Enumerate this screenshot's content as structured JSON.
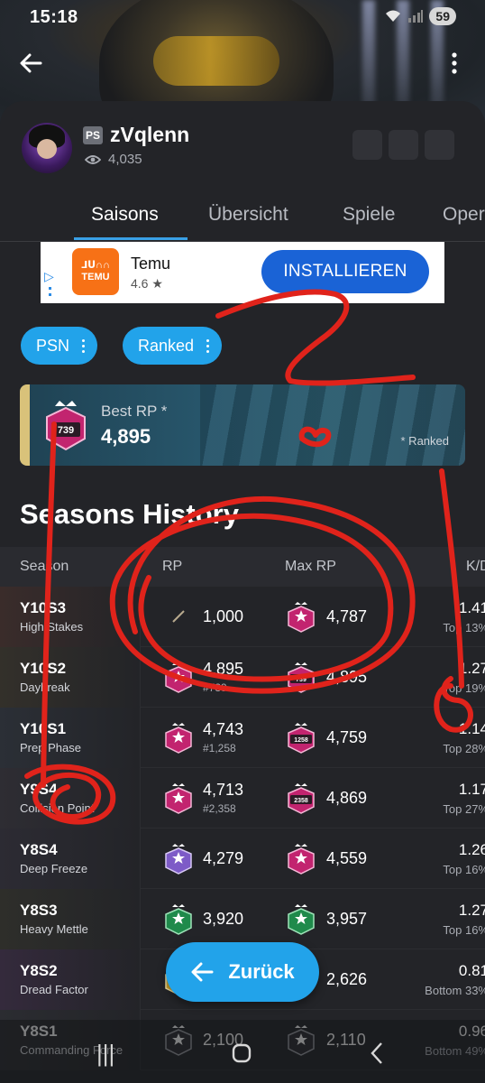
{
  "status": {
    "time": "15:18",
    "battery": "59"
  },
  "profile": {
    "platform_badge": "PS",
    "username": "zVqlenn",
    "views": "4,035"
  },
  "tabs": [
    {
      "label": "Saisons",
      "active": true
    },
    {
      "label": "Übersicht",
      "active": false
    },
    {
      "label": "Spiele",
      "active": false
    },
    {
      "label": "Oper",
      "active": false
    }
  ],
  "ad": {
    "app_name": "Temu",
    "logo_line1": "⅃ᑌ∩∩",
    "logo_line2": "TEMU",
    "rating": "4.6 ★",
    "install_label": "INSTALLIEREN"
  },
  "filters": {
    "platform": "PSN",
    "mode": "Ranked"
  },
  "best_rp": {
    "label": "Best RP *",
    "value": "4,895",
    "badge_number": "739",
    "note": "* Ranked"
  },
  "section_title": "Seasons History",
  "table": {
    "headers": {
      "season": "Season",
      "rp": "RP",
      "max_rp": "Max RP",
      "kd": "K/D"
    },
    "rows": [
      {
        "code": "Y10S3",
        "name": "High Stakes",
        "rp": "1,000",
        "rp_rank": "",
        "max_rp": "4,787",
        "kd": "1.41",
        "kd_rank": "Top 13%",
        "rp_badge": "none",
        "max_badge": "champion",
        "max_badge_text": ""
      },
      {
        "code": "Y10S2",
        "name": "Daybreak",
        "rp": "4,895",
        "rp_rank": "#739",
        "max_rp": "4,895",
        "kd": "1.27",
        "kd_rank": "Top 19%",
        "rp_badge": "champion",
        "max_badge": "champion",
        "max_badge_text": "739"
      },
      {
        "code": "Y10S1",
        "name": "Prep Phase",
        "rp": "4,743",
        "rp_rank": "#1,258",
        "max_rp": "4,759",
        "kd": "1.14",
        "kd_rank": "Top 28%",
        "rp_badge": "champion",
        "max_badge": "champion",
        "max_badge_text": "1258"
      },
      {
        "code": "Y9S4",
        "name": "Collision Point",
        "rp": "4,713",
        "rp_rank": "#2,358",
        "max_rp": "4,869",
        "kd": "1.17",
        "kd_rank": "Top 27%",
        "rp_badge": "champion",
        "max_badge": "champion",
        "max_badge_text": "2358"
      },
      {
        "code": "Y8S4",
        "name": "Deep Freeze",
        "rp": "4,279",
        "rp_rank": "",
        "max_rp": "4,559",
        "kd": "1.26",
        "kd_rank": "Top 16%",
        "rp_badge": "diamond",
        "max_badge": "champion",
        "max_badge_text": ""
      },
      {
        "code": "Y8S3",
        "name": "Heavy Mettle",
        "rp": "3,920",
        "rp_rank": "",
        "max_rp": "3,957",
        "kd": "1.27",
        "kd_rank": "Top 16%",
        "rp_badge": "emerald",
        "max_badge": "emerald",
        "max_badge_text": ""
      },
      {
        "code": "Y8S2",
        "name": "Dread Factor",
        "rp": "",
        "rp_rank": "",
        "max_rp": "2,626",
        "kd": "0.81",
        "kd_rank": "Bottom 33%",
        "rp_badge": "gold",
        "max_badge": "none",
        "max_badge_text": ""
      },
      {
        "code": "Y8S1",
        "name": "Commanding Force",
        "rp": "2,100",
        "rp_rank": "",
        "max_rp": "2,110",
        "kd": "0.96",
        "kd_rank": "Bottom 49%",
        "rp_badge": "silver",
        "max_badge": "silver",
        "max_badge_text": ""
      }
    ]
  },
  "fab": {
    "label": "Zurück"
  },
  "colors": {
    "accent": "#22a3ea",
    "background": "#1c1d21",
    "card": "#232428",
    "scribble": "#e0231b"
  }
}
